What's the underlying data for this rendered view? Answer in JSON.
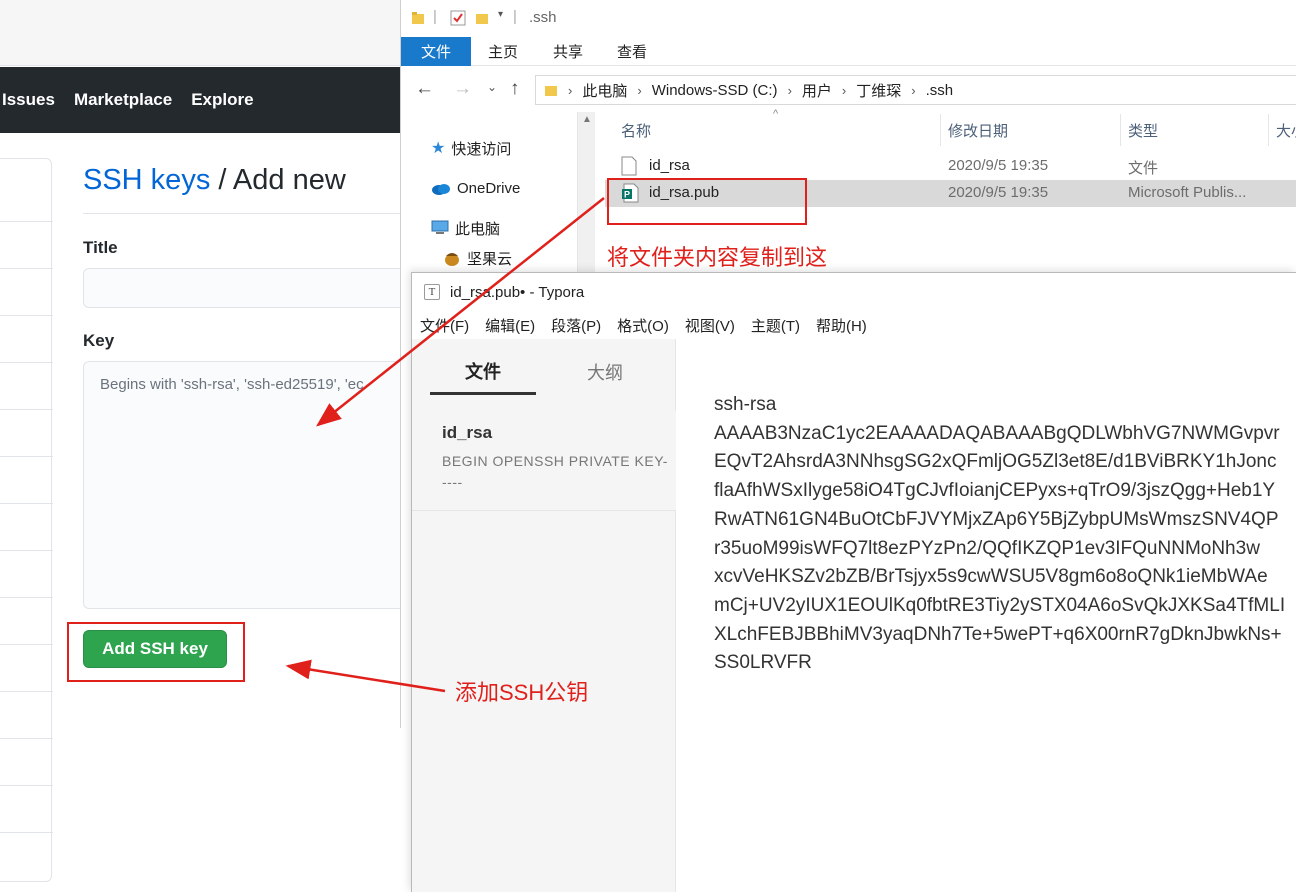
{
  "github": {
    "nav": [
      "Issues",
      "Marketplace",
      "Explore"
    ],
    "title_crumb": "SSH keys",
    "title_sep": " / ",
    "title_tail": "Add new",
    "title_label": "Title",
    "key_label": "Key",
    "key_placeholder": "Begins with 'ssh-rsa', 'ssh-ed25519', 'ec",
    "add_button": "Add SSH key"
  },
  "explorer": {
    "qat_path": ".ssh",
    "tabs": [
      "文件",
      "主页",
      "共享",
      "查看"
    ],
    "breadcrumb": [
      "此电脑",
      "Windows-SSD (C:)",
      "用户",
      "丁维琛",
      ".ssh"
    ],
    "nav_items": [
      {
        "label": "快速访问",
        "icon": "star-icon"
      },
      {
        "label": "OneDrive",
        "icon": "cloud-icon"
      },
      {
        "label": "此电脑",
        "icon": "computer-icon"
      },
      {
        "label": "坚果云",
        "icon": "nut-icon"
      }
    ],
    "columns": [
      "名称",
      "修改日期",
      "类型",
      "大小"
    ],
    "files": [
      {
        "name": "id_rsa",
        "date": "2020/9/5 19:35",
        "type": "文件",
        "icon": "file-icon"
      },
      {
        "name": "id_rsa.pub",
        "date": "2020/9/5 19:35",
        "type": "Microsoft Publis...",
        "icon": "publisher-file-icon"
      }
    ]
  },
  "typora": {
    "window_title": "id_rsa.pub• - Typora",
    "menu": [
      "文件(F)",
      "编辑(E)",
      "段落(P)",
      "格式(O)",
      "视图(V)",
      "主题(T)",
      "帮助(H)"
    ],
    "sidebar_tabs": [
      "文件",
      "大纲"
    ],
    "file_item": {
      "name": "id_rsa",
      "preview": "BEGIN OPENSSH PRIVATE KEY-----"
    },
    "content_lines": [
      "ssh-rsa",
      "AAAAB3NzaC1yc2EAAAADAQABAAABgQDLWbhVG7NWMGvpvr",
      "EQvT2AhsrdA3NNhsgSG2xQFmljOG5Zl3et8E/d1BViBRKY1hJonc",
      "flaAfhWSxIlyge58iO4TgCJvfIoianjCEPyxs+qTrO9/3jszQgg+Heb1Y",
      "RwATN61GN4BuOtCbFJVYMjxZAp6Y5BjZybpUMsWmszSNV4QP",
      "r35uoM99isWFQ7lt8ezPYzPn2/QQfIKZQP1ev3IFQuNNMoNh3w",
      "xcvVeHKSZv2bZB/BrTsjyx5s9cwWSU5V8gm6o8oQNk1ieMbWAe",
      "mCj+UV2yIUX1EOUlKq0fbtRE3Tiy2ySTX04A6oSvQkJXKSa4TfMLI",
      "XLchFEBJBBhiMV3yaqDNh7Te+5wePT+q6X00rnR7gDknJbwkNs+",
      "SS0LRVFR"
    ]
  },
  "annotations": {
    "copy_note": "将文件夹内容复制到这",
    "add_note": "添加SSH公钥"
  },
  "colors": {
    "annotation_red": "#e0201b",
    "github_green": "#2ea44f",
    "github_link": "#0366d6",
    "github_header": "#24292e",
    "explorer_blue": "#1979ca"
  }
}
